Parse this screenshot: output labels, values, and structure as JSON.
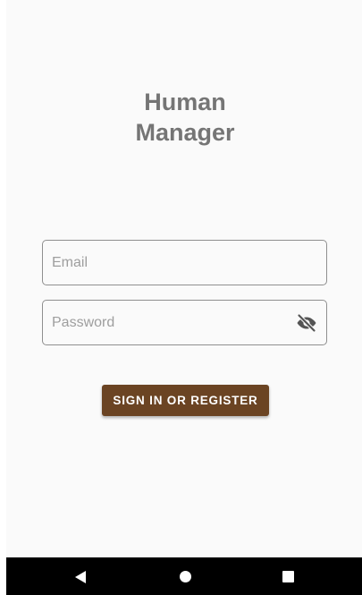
{
  "app": {
    "title_line1": "Human",
    "title_line2": "Manager"
  },
  "form": {
    "email": {
      "placeholder": "Email",
      "value": ""
    },
    "password": {
      "placeholder": "Password",
      "value": "",
      "toggle_icon": "eye-off-icon"
    },
    "submit_label": "SIGN IN OR REGISTER"
  },
  "nav": {
    "back_icon": "back-triangle-icon",
    "home_icon": "home-circle-icon",
    "recents_icon": "recents-square-icon"
  },
  "colors": {
    "background": "#fafafa",
    "title": "#757575",
    "button": "#6b4423",
    "border": "#8f8f8f"
  }
}
